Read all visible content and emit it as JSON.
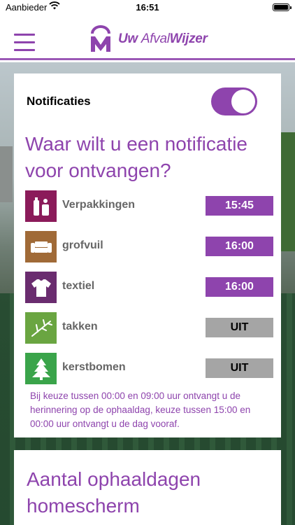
{
  "status_bar": {
    "carrier": "Aanbieder",
    "time": "16:51"
  },
  "header": {
    "logo_prefix": "Uw ",
    "logo_mid": "Afval",
    "logo_suffix": "Wijzer"
  },
  "notifications": {
    "label": "Notificaties",
    "enabled": true,
    "question": "Waar wilt u een notificatie voor ontvangen?"
  },
  "items": [
    {
      "name": "Verpakkingen",
      "value": "15:45",
      "state": "on",
      "icon": "packaging-icon",
      "color": "#8b1b5a"
    },
    {
      "name": "grofvuil",
      "value": "16:00",
      "state": "on",
      "icon": "sofa-icon",
      "color": "#a06a37"
    },
    {
      "name": "textiel",
      "value": "16:00",
      "state": "on",
      "icon": "shirt-icon",
      "color": "#6a2c6f"
    },
    {
      "name": "takken",
      "value": "UIT",
      "state": "off",
      "icon": "branch-icon",
      "color": "#6aa541"
    },
    {
      "name": "kerstbomen",
      "value": "UIT",
      "state": "off",
      "icon": "christmas-tree-icon",
      "color": "#3aa44a"
    }
  ],
  "info_text": "Bij keuze tussen 00:00 en 09:00 uur ontvangt u de herinnering op de ophaaldag, keuze tussen 15:00 en 00:00 uur ontvangt u de dag vooraf.",
  "section2_title": "Aantal ophaaldagen homescherm",
  "colors": {
    "accent": "#8e44ad",
    "off": "#a5a5a5"
  }
}
